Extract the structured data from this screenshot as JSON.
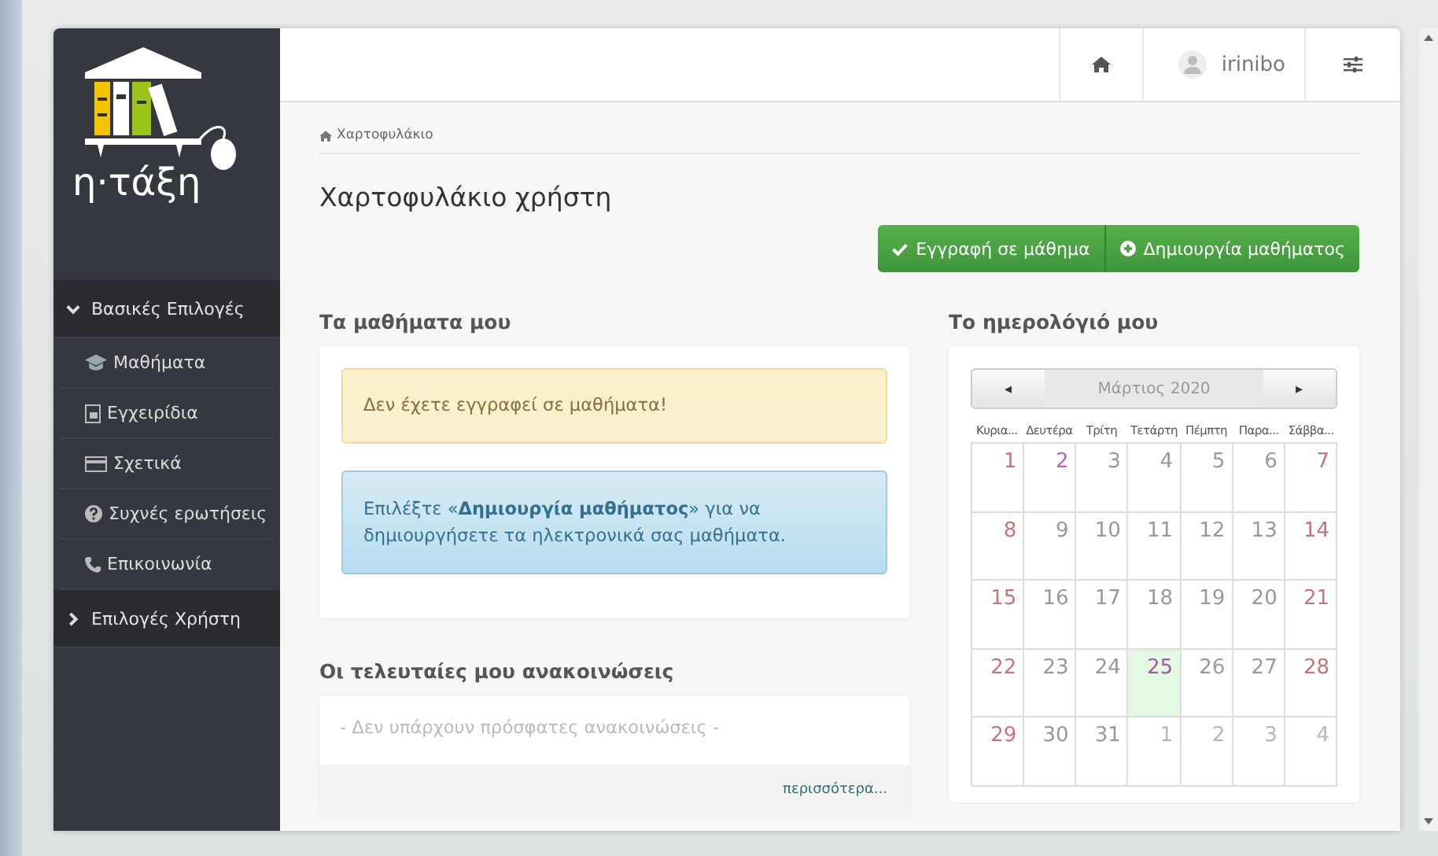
{
  "logo": {
    "text": "η·τάξη"
  },
  "sidebar": {
    "groups": [
      {
        "label": "Βασικές Επιλογές",
        "expanded": true,
        "items": [
          {
            "label": "Μαθήματα"
          },
          {
            "label": "Εγχειρίδια"
          },
          {
            "label": "Σχετικά"
          },
          {
            "label": "Συχνές ερωτήσεις"
          },
          {
            "label": "Επικοινωνία"
          }
        ]
      },
      {
        "label": "Επιλογές Χρήστη",
        "expanded": false
      }
    ]
  },
  "topbar": {
    "username": "irinibo"
  },
  "breadcrumb": "Χαρτοφυλάκιο",
  "page_title": "Χαρτοφυλάκιο χρήστη",
  "actions": [
    {
      "label": "Εγγραφή σε μάθημα"
    },
    {
      "label": "Δημιουργία μαθήματος"
    }
  ],
  "courses": {
    "heading": "Τα μαθήματα μου",
    "alerts": [
      {
        "kind": "warning",
        "text": "Δεν έχετε εγγραφεί σε μαθήματα!"
      },
      {
        "kind": "info",
        "text": "Επιλέξτε «**Δημιουργία μαθήματος**» για να δημιουργήσετε τα ηλεκτρονικά σας μαθήματα."
      }
    ]
  },
  "announcements": {
    "heading": "Οι τελευταίες μου ανακοινώσεις",
    "empty": "- Δεν υπάρχουν πρόσφατες ανακοινώσεις -",
    "more": "περισσότερα..."
  },
  "calendar": {
    "heading": "Το ημερολόγιό μου",
    "month": "Μάρτιος 2020",
    "prev": "◂",
    "next": "▸",
    "weekdays": [
      "Κυρια...",
      "Δευτέρα",
      "Τρίτη",
      "Τετάρτη",
      "Πέμπτη",
      "Παρα...",
      "Σάββα..."
    ],
    "weeks": [
      [
        {
          "day": "1",
          "kind": "weekend"
        },
        {
          "day": "2",
          "kind": "holiday"
        },
        {
          "day": "3",
          "kind": "normal"
        },
        {
          "day": "4",
          "kind": "normal"
        },
        {
          "day": "5",
          "kind": "normal"
        },
        {
          "day": "6",
          "kind": "normal"
        },
        {
          "day": "7",
          "kind": "weekend"
        }
      ],
      [
        {
          "day": "8",
          "kind": "weekend"
        },
        {
          "day": "9",
          "kind": "normal"
        },
        {
          "day": "10",
          "kind": "normal"
        },
        {
          "day": "11",
          "kind": "normal"
        },
        {
          "day": "12",
          "kind": "normal"
        },
        {
          "day": "13",
          "kind": "normal"
        },
        {
          "day": "14",
          "kind": "weekend"
        }
      ],
      [
        {
          "day": "15",
          "kind": "weekend"
        },
        {
          "day": "16",
          "kind": "normal"
        },
        {
          "day": "17",
          "kind": "normal"
        },
        {
          "day": "18",
          "kind": "normal"
        },
        {
          "day": "19",
          "kind": "normal"
        },
        {
          "day": "20",
          "kind": "normal"
        },
        {
          "day": "21",
          "kind": "weekend"
        }
      ],
      [
        {
          "day": "22",
          "kind": "weekend"
        },
        {
          "day": "23",
          "kind": "normal"
        },
        {
          "day": "24",
          "kind": "normal"
        },
        {
          "day": "25",
          "kind": "today"
        },
        {
          "day": "26",
          "kind": "normal"
        },
        {
          "day": "27",
          "kind": "normal"
        },
        {
          "day": "28",
          "kind": "weekend"
        }
      ],
      [
        {
          "day": "29",
          "kind": "weekend"
        },
        {
          "day": "30",
          "kind": "normal"
        },
        {
          "day": "31",
          "kind": "normal"
        },
        {
          "day": "1",
          "kind": "other"
        },
        {
          "day": "2",
          "kind": "other"
        },
        {
          "day": "3",
          "kind": "other"
        },
        {
          "day": "4",
          "kind": "other"
        }
      ]
    ]
  }
}
